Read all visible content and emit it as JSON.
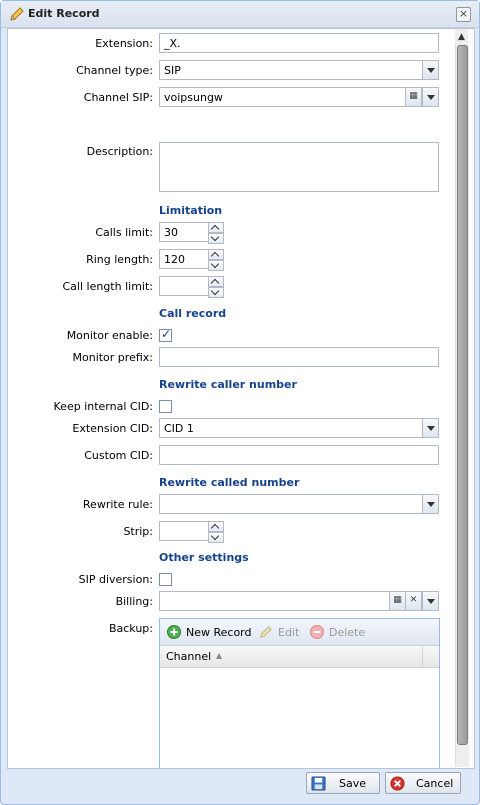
{
  "window": {
    "title": "Edit Record",
    "close_label": "×"
  },
  "form": {
    "extension": {
      "label": "Extension:",
      "value": "_X."
    },
    "channel_type": {
      "label": "Channel type:",
      "value": "SIP"
    },
    "channel_sip": {
      "label": "Channel SIP:",
      "value": "voipsungw"
    },
    "description": {
      "label": "Description:",
      "value": ""
    },
    "limitation": {
      "heading": "Limitation",
      "calls_limit": {
        "label": "Calls limit:",
        "value": "30"
      },
      "ring_length": {
        "label": "Ring length:",
        "value": "120"
      },
      "call_length_limit": {
        "label": "Call length limit:",
        "value": ""
      }
    },
    "call_record": {
      "heading": "Call record",
      "monitor_enable": {
        "label": "Monitor enable:",
        "checked": true
      },
      "monitor_prefix": {
        "label": "Monitor prefix:",
        "value": ""
      }
    },
    "rewrite_caller": {
      "heading": "Rewrite caller number",
      "keep_internal_cid": {
        "label": "Keep internal CID:",
        "checked": false
      },
      "extension_cid": {
        "label": "Extension CID:",
        "value": "CID 1"
      },
      "custom_cid": {
        "label": "Custom CID:",
        "value": ""
      }
    },
    "rewrite_called": {
      "heading": "Rewrite called number",
      "rewrite_rule": {
        "label": "Rewrite rule:",
        "value": ""
      },
      "strip": {
        "label": "Strip:",
        "value": ""
      }
    },
    "other": {
      "heading": "Other settings",
      "sip_diversion": {
        "label": "SIP diversion:",
        "checked": false
      },
      "billing": {
        "label": "Billing:",
        "value": ""
      },
      "backup": {
        "label": "Backup:",
        "toolbar": {
          "new_record": "New Record",
          "edit": "Edit",
          "delete": "Delete"
        },
        "columns": [
          "Channel"
        ]
      }
    }
  },
  "footer": {
    "save_label": "Save",
    "cancel_label": "Cancel"
  },
  "colors": {
    "section_heading": "#15428b",
    "window_border": "#99bbe8"
  }
}
